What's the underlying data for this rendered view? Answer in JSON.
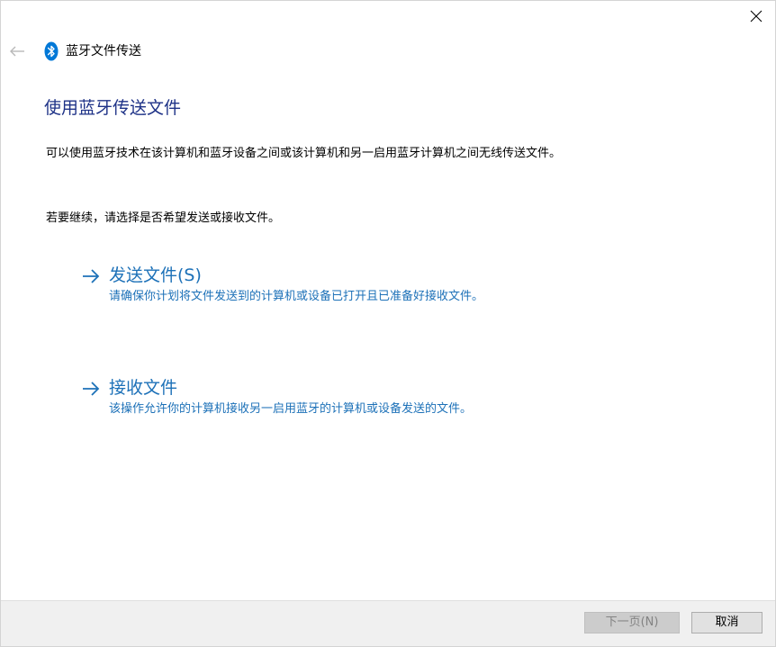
{
  "window": {
    "title": "蓝牙文件传送",
    "close_icon": "close-icon",
    "back_icon": "back-arrow-icon",
    "app_icon": "bluetooth-icon"
  },
  "main": {
    "heading": "使用蓝牙传送文件",
    "description": "可以使用蓝牙技术在该计算机和蓝牙设备之间或该计算机和另一启用蓝牙计算机之间无线传送文件。",
    "prompt": "若要继续，请选择是否希望发送或接收文件。",
    "options": [
      {
        "title": "发送文件(S)",
        "subtitle": "请确保你计划将文件发送到的计算机或设备已打开且已准备好接收文件。",
        "icon": "arrow-right-icon"
      },
      {
        "title": "接收文件",
        "subtitle": "该操作允许你的计算机接收另一启用蓝牙的计算机或设备发送的文件。",
        "icon": "arrow-right-icon"
      }
    ]
  },
  "footer": {
    "next_label": "下一页(N)",
    "cancel_label": "取消"
  },
  "colors": {
    "heading": "#1e3287",
    "link": "#1d71b8",
    "bluetooth": "#0078d7",
    "footer_bg": "#f0f0f0",
    "disabled_button": "#cccccc"
  }
}
